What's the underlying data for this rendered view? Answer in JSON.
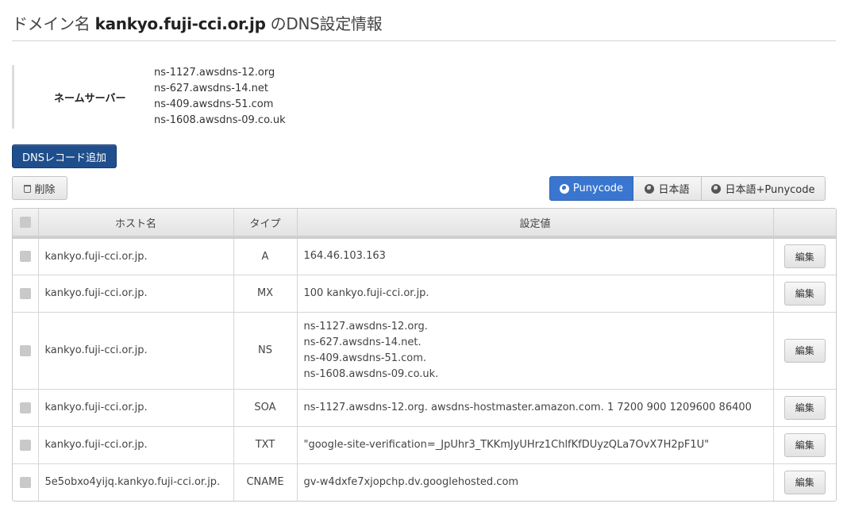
{
  "page": {
    "title_prefix": "ドメイン名 ",
    "domain": "kankyo.fuji-cci.or.jp",
    "title_suffix": " のDNS設定情報"
  },
  "nameservers": {
    "label": "ネームサーバー",
    "items": [
      "ns-1127.awsdns-12.org",
      "ns-627.awsdns-14.net",
      "ns-409.awsdns-51.com",
      "ns-1608.awsdns-09.co.uk"
    ]
  },
  "actions": {
    "add_record": "DNSレコード追加",
    "delete": "削除"
  },
  "display_mode": {
    "options": [
      {
        "label": "Punycode",
        "icon": "globe-icon",
        "active": true
      },
      {
        "label": "日本語",
        "icon": "globe-icon",
        "active": false
      },
      {
        "label": "日本語+Punycode",
        "icon": "globe-icon",
        "active": false
      }
    ]
  },
  "table": {
    "headers": {
      "host": "ホスト名",
      "type": "タイプ",
      "value": "設定値"
    },
    "edit_label": "編集",
    "rows": [
      {
        "host": "kankyo.fuji-cci.or.jp.",
        "type": "A",
        "values": [
          "164.46.103.163"
        ]
      },
      {
        "host": "kankyo.fuji-cci.or.jp.",
        "type": "MX",
        "values": [
          "100 kankyo.fuji-cci.or.jp."
        ]
      },
      {
        "host": "kankyo.fuji-cci.or.jp.",
        "type": "NS",
        "values": [
          "ns-1127.awsdns-12.org.",
          "ns-627.awsdns-14.net.",
          "ns-409.awsdns-51.com.",
          "ns-1608.awsdns-09.co.uk."
        ]
      },
      {
        "host": "kankyo.fuji-cci.or.jp.",
        "type": "SOA",
        "values": [
          "ns-1127.awsdns-12.org. awsdns-hostmaster.amazon.com. 1 7200 900 1209600 86400"
        ]
      },
      {
        "host": "kankyo.fuji-cci.or.jp.",
        "type": "TXT",
        "values": [
          "\"google-site-verification=_JpUhr3_TKKmJyUHrz1ChlfKfDUyzQLa7OvX7H2pF1U\""
        ]
      },
      {
        "host": "5e5obxo4yijq.kankyo.fuji-cci.or.jp.",
        "type": "CNAME",
        "values": [
          "gv-w4dxfe7xjopchp.dv.googlehosted.com"
        ]
      }
    ]
  },
  "colors": {
    "primary_button": "#1f4e8c",
    "active_segment": "#3a76d0"
  }
}
